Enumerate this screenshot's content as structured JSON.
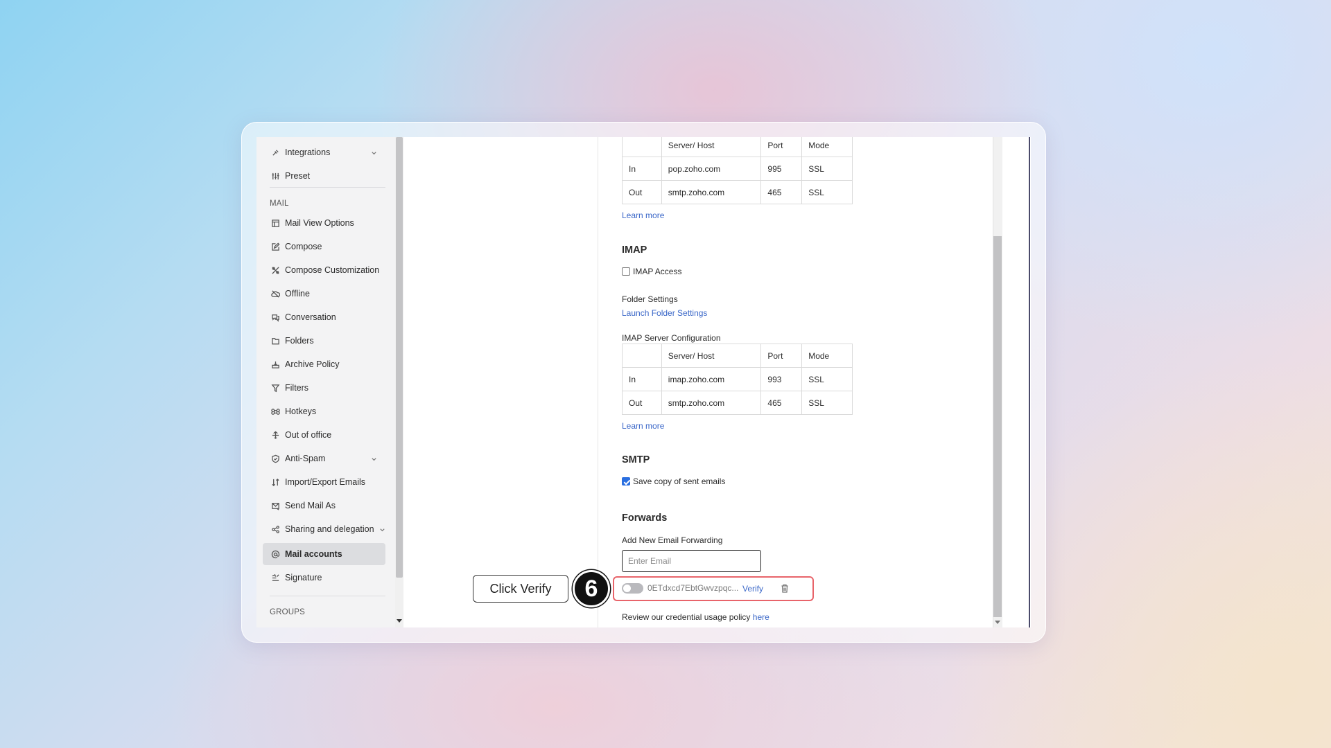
{
  "sidebar": {
    "items_top": [
      {
        "label": "Integrations",
        "icon": "integrations-icon",
        "has_chevron": true
      },
      {
        "label": "Preset",
        "icon": "preset-icon",
        "has_chevron": false
      }
    ],
    "mail_section_label": "MAIL",
    "mail_items": [
      {
        "label": "Mail View Options",
        "icon": "mail-view-icon"
      },
      {
        "label": "Compose",
        "icon": "compose-icon"
      },
      {
        "label": "Compose Customization",
        "icon": "compose-customization-icon"
      },
      {
        "label": "Offline",
        "icon": "offline-icon"
      },
      {
        "label": "Conversation",
        "icon": "conversation-icon"
      },
      {
        "label": "Folders",
        "icon": "folder-icon"
      },
      {
        "label": "Archive Policy",
        "icon": "archive-icon"
      },
      {
        "label": "Filters",
        "icon": "filter-icon"
      },
      {
        "label": "Hotkeys",
        "icon": "hotkeys-icon"
      },
      {
        "label": "Out of office",
        "icon": "out-of-office-icon"
      },
      {
        "label": "Anti-Spam",
        "icon": "shield-icon"
      },
      {
        "label": "Import/Export Emails",
        "icon": "import-export-icon"
      },
      {
        "label": "Send Mail As",
        "icon": "send-mail-icon"
      },
      {
        "label": "Sharing and delegation",
        "icon": "share-icon"
      },
      {
        "label": "Mail accounts",
        "icon": "at-sign-icon"
      },
      {
        "label": "Signature",
        "icon": "signature-icon"
      }
    ],
    "groups_section_label": "GROUPS"
  },
  "pop": {
    "table": {
      "headers": [
        "",
        "Server/ Host",
        "Port",
        "Mode"
      ],
      "rows": [
        [
          "In",
          "pop.zoho.com",
          "995",
          "SSL"
        ],
        [
          "Out",
          "smtp.zoho.com",
          "465",
          "SSL"
        ]
      ]
    },
    "learn_more": "Learn more"
  },
  "imap": {
    "heading": "IMAP",
    "access_label": "IMAP Access",
    "access_checked": false,
    "folder_settings_label": "Folder Settings",
    "launch_folder_settings": "Launch Folder Settings",
    "server_config_label": "IMAP Server Configuration",
    "table": {
      "headers": [
        "",
        "Server/ Host",
        "Port",
        "Mode"
      ],
      "rows": [
        [
          "In",
          "imap.zoho.com",
          "993",
          "SSL"
        ],
        [
          "Out",
          "smtp.zoho.com",
          "465",
          "SSL"
        ]
      ]
    },
    "learn_more": "Learn more"
  },
  "smtp": {
    "heading": "SMTP",
    "save_copy_label": "Save copy of sent emails",
    "save_copy_checked": true
  },
  "forwards": {
    "heading": "Forwards",
    "add_new_label": "Add New Email Forwarding",
    "email_placeholder": "Enter Email",
    "entry_value": "0ETdxcd7EbtGwvzpqc...",
    "entry_enabled": false,
    "verify_label": "Verify"
  },
  "policy": {
    "text": "Review our credential usage policy",
    "link": "here"
  },
  "callout": {
    "text": "Click Verify",
    "step": "6"
  },
  "colors": {
    "link": "#3a67c8",
    "highlight_border": "#e8646a",
    "checkbox_checked": "#2a6fe0"
  }
}
